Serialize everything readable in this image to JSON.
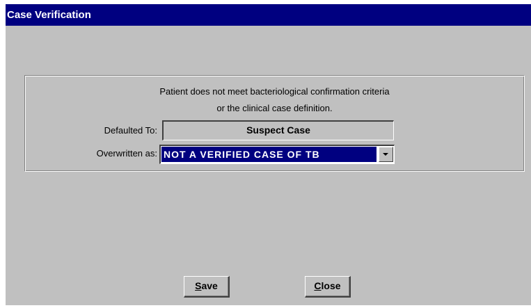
{
  "window": {
    "title": "Case Verification"
  },
  "group": {
    "message_line1": "Patient does not meet bacteriological confirmation criteria",
    "message_line2": "or the clinical case definition.",
    "defaulted_label": "Defaulted To:",
    "defaulted_value": "Suspect Case",
    "overwritten_label": "Overwritten as:",
    "overwritten_value": "NOT A VERIFIED CASE OF TB"
  },
  "buttons": {
    "save_mnemonic": "S",
    "save_rest": "ave",
    "close_mnemonic": "C",
    "close_rest": "lose"
  },
  "icons": {
    "dropdown": "chevron-down-icon"
  }
}
